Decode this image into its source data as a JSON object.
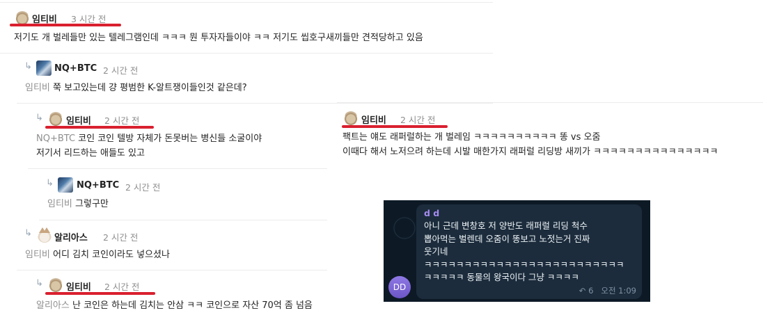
{
  "comments": [
    {
      "name": "임티비",
      "time": "3 시간 전",
      "text": "저기도 개 벌레들만 있는 텔레그램인데 ㅋㅋㅋ 뭔 투자자들이야 ㅋㅋ 저기도 씹호구새끼들만 견적당하고 있음"
    },
    {
      "name": "NQ+BTC",
      "time": "2 시간 전",
      "mention": "임티비",
      "text": "쭉 보고있는데 걍 평범한 K-알트쟁이들인것 같은데?"
    },
    {
      "name": "임티비",
      "time": "2 시간 전",
      "mention": "NQ+BTC",
      "text_line1": "코인 코인 텔방 자체가 돈못버는 병신들 소굴이야",
      "text_line2": "저기서 리드하는 애들도 있고"
    },
    {
      "name": "NQ+BTC",
      "time": "2 시간 전",
      "mention": "임티비",
      "text": "그렇구만"
    },
    {
      "name": "알리아스",
      "time": "2 시간 전",
      "mention": "임티비",
      "text": "어디 김치 코인이라도 넣으셨나"
    },
    {
      "name": "임티비",
      "time": "2 시간 전",
      "mention": "알리아스",
      "text": "난 코인은 하는데 김치는 안삼 ㅋㅋ 코인으로 자산 70억 좀 넘음"
    },
    {
      "name": "임티비",
      "time": "2 시간 전",
      "text_line1": "팩트는 얘도 래퍼럴하는 개 벌레임 ㅋㅋㅋㅋㅋㅋㅋㅋㅋㅋ 똥 vs 오줌",
      "text_line2": "이때다 해서 노저으려 하는데 시발 매한가지 래퍼럴 리딩방 새끼가 ㅋㅋㅋㅋㅋㅋㅋㅋㅋㅋㅋㅋㅋㅋㅋ"
    }
  ],
  "telegram": {
    "sender": "d d",
    "avatar_initials": "DD",
    "lines": [
      "아니 근데 변창호 저 양반도 래퍼럴 리딩 척수",
      "뽑아먹는 벌렌데 오줌이 똥보고 노젓는거 진짜",
      "웃기네",
      "ㅋㅋㅋㅋㅋㅋㅋㅋㅋㅋㅋㅋㅋㅋㅋㅋㅋㅋㅋㅋㅋㅋㅋㅋㅋ",
      "ㅋㅋㅋㅋㅋ 동물의 왕국이다 그냥 ㅋㅋㅋㅋ"
    ],
    "reply_count": "6",
    "timestamp": "오전 1:09"
  },
  "icons": {
    "reply_arrow": "reply-arrow-icon",
    "forward": "forward-icon"
  },
  "colors": {
    "highlight_underline": "#d9202f",
    "telegram_bg": "#0d1a26",
    "telegram_sender": "#a48bf0"
  }
}
